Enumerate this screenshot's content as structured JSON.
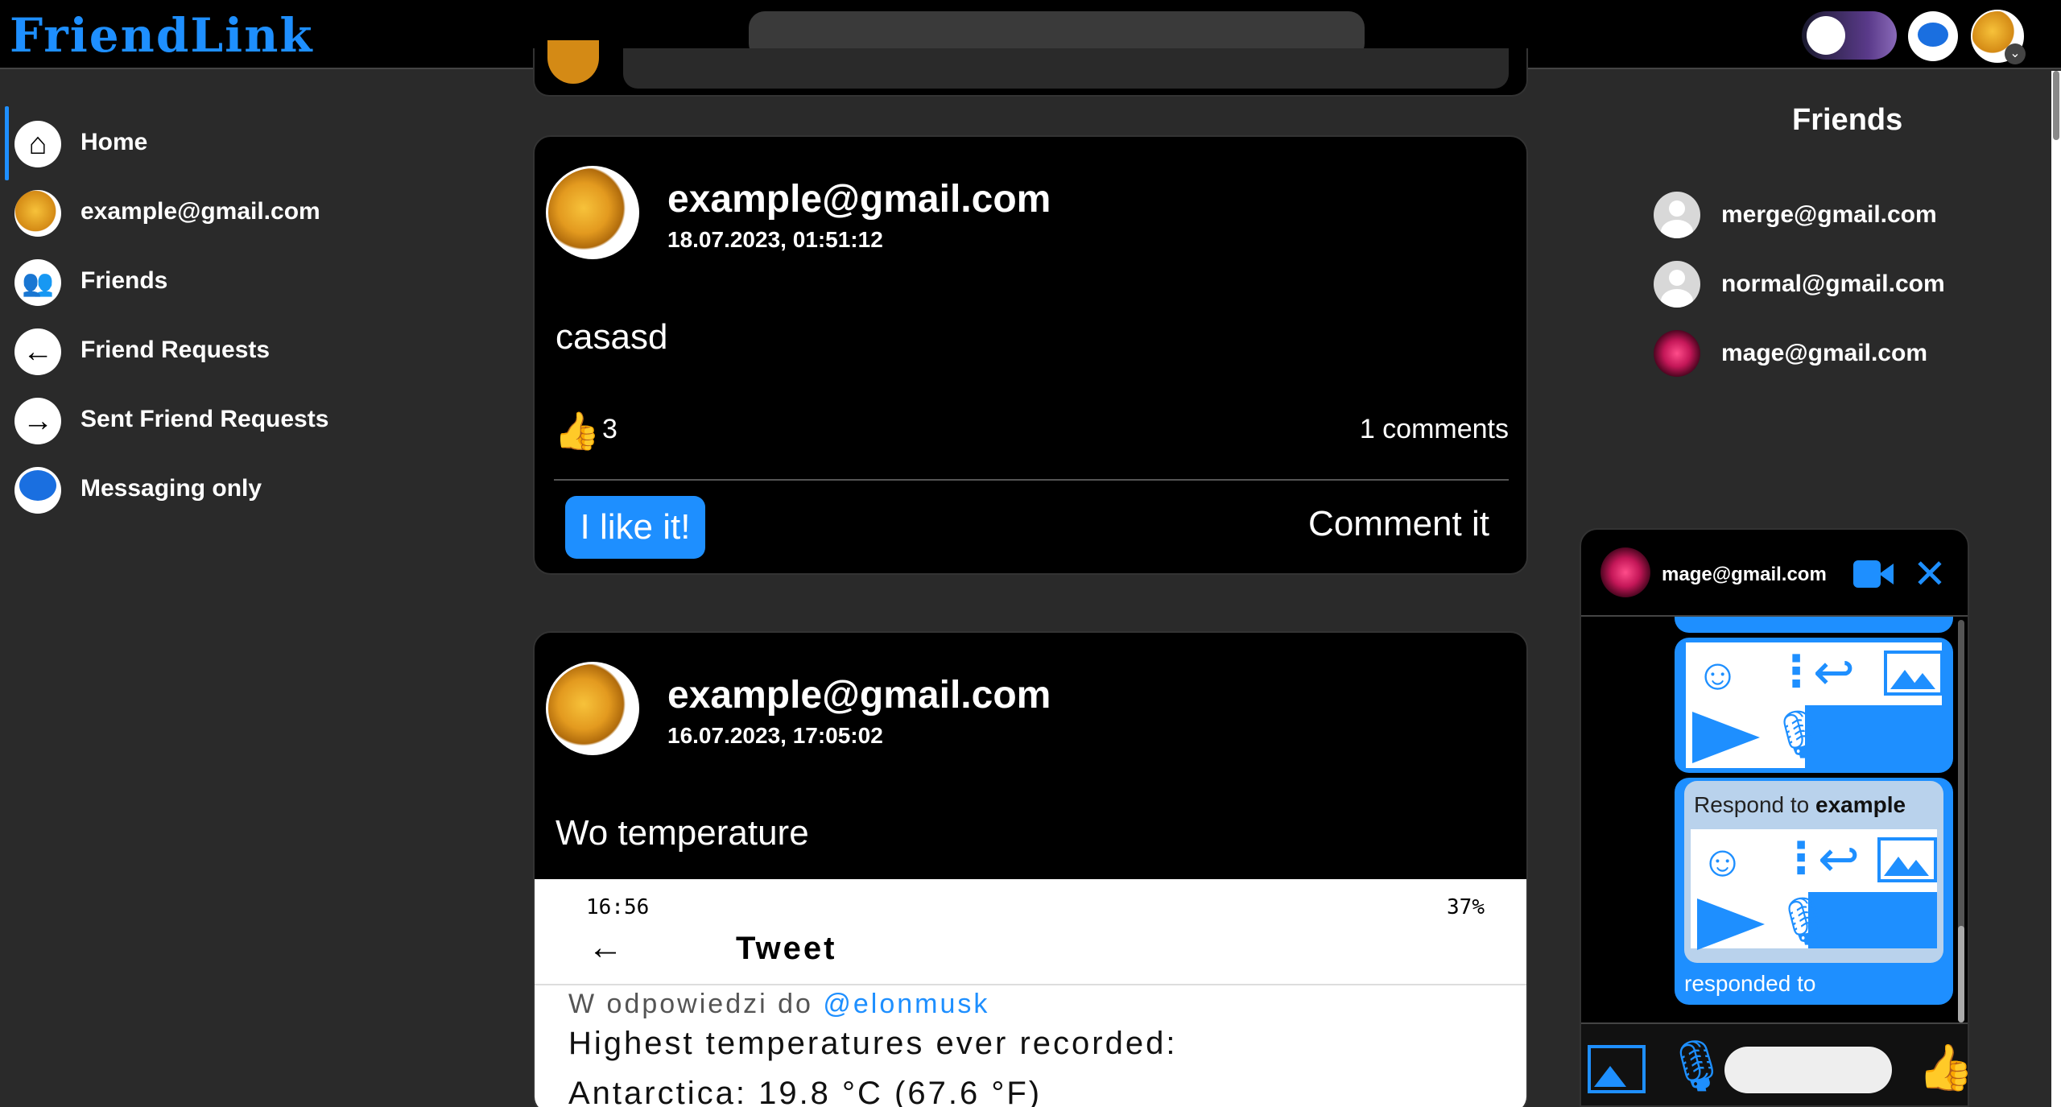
{
  "app": {
    "logo": "FriendLink"
  },
  "header": {
    "search_placeholder": ""
  },
  "nav": {
    "items": [
      {
        "label": "Home",
        "icon": "home-icon",
        "active": true
      },
      {
        "label": "example@gmail.com",
        "icon": "user-avatar"
      },
      {
        "label": "Friends",
        "icon": "friends-icon"
      },
      {
        "label": "Friend Requests",
        "icon": "arrow-left-icon"
      },
      {
        "label": "Sent Friend Requests",
        "icon": "arrow-right-icon"
      },
      {
        "label": "Messaging only",
        "icon": "message-bubble-icon"
      }
    ]
  },
  "posts": [
    {
      "author": "example@gmail.com",
      "date": "18.07.2023, 01:51:12",
      "body": "casasd",
      "likes": "3",
      "comments": "1 comments",
      "like_button": "I like it!",
      "comment_button": "Comment it"
    },
    {
      "author": "example@gmail.com",
      "date": "16.07.2023, 17:05:02",
      "body": "Wo temperature",
      "image": {
        "time": "16:56",
        "status": "37%",
        "title": "Tweet",
        "reply_prefix": "W odpowiedzi do ",
        "reply_handle": "@elonmusk",
        "headline": "Highest temperatures ever recorded:",
        "line1": "Antarctica: 19.8 °C (67.6 °F)"
      }
    }
  ],
  "friends": {
    "title": "Friends",
    "list": [
      {
        "email": "merge@gmail.com",
        "avatar": "default"
      },
      {
        "email": "normal@gmail.com",
        "avatar": "default"
      },
      {
        "email": "mage@gmail.com",
        "avatar": "pink"
      }
    ]
  },
  "chat": {
    "contact": "mage@gmail.com",
    "respond_prefix": "Respond to ",
    "respond_name": "example",
    "responded_label": "responded to",
    "input_placeholder": ""
  },
  "colors": {
    "accent": "#1e8fff",
    "background": "#2a2a2a",
    "card": "#000000"
  }
}
